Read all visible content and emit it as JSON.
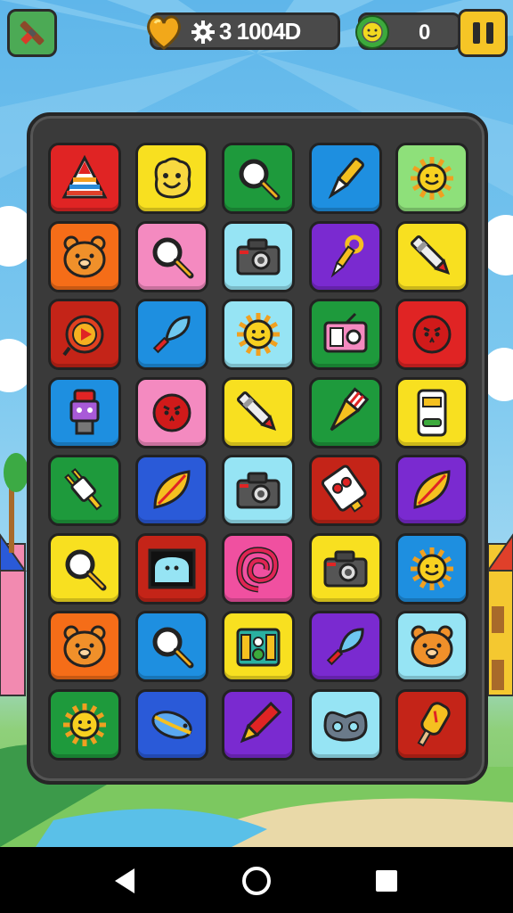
{
  "hud": {
    "coins": "3 1004D",
    "score": "0"
  },
  "colors": {
    "red": "#e02424",
    "yellow": "#f8e020",
    "green": "#1e9a3c",
    "blue": "#1e8fe0",
    "lightgreen": "#8ee07a",
    "orange": "#f56d18",
    "pink": "#f48ac0",
    "cyan": "#96e4f4",
    "purple": "#7a2ad0",
    "darkred": "#c42418",
    "royal": "#2a5ad8",
    "magenta": "#f050a0"
  },
  "board": {
    "rows": [
      [
        {
          "color": "red",
          "icon": "rainbow-pyramid-icon"
        },
        {
          "color": "yellow",
          "icon": "smiling-blob-icon"
        },
        {
          "color": "green",
          "icon": "magnifier-icon"
        },
        {
          "color": "blue",
          "icon": "pen-nib-icon"
        },
        {
          "color": "lightgreen",
          "icon": "sun-face-icon"
        }
      ],
      [
        {
          "color": "orange",
          "icon": "bear-face-icon"
        },
        {
          "color": "pink",
          "icon": "magnifier-icon"
        },
        {
          "color": "cyan",
          "icon": "camera-icon"
        },
        {
          "color": "purple",
          "icon": "wrench-pen-icon"
        },
        {
          "color": "yellow",
          "icon": "marker-icon"
        }
      ],
      [
        {
          "color": "darkred",
          "icon": "play-badge-icon"
        },
        {
          "color": "blue",
          "icon": "feather-brush-icon"
        },
        {
          "color": "cyan",
          "icon": "sun-face-icon"
        },
        {
          "color": "green",
          "icon": "radio-camera-icon"
        },
        {
          "color": "red",
          "icon": "round-face-icon"
        }
      ],
      [
        {
          "color": "blue",
          "icon": "robot-icon"
        },
        {
          "color": "pink",
          "icon": "round-face-icon"
        },
        {
          "color": "yellow",
          "icon": "marker-icon"
        },
        {
          "color": "green",
          "icon": "paint-brush-icon"
        },
        {
          "color": "yellow",
          "icon": "phone-icon"
        }
      ],
      [
        {
          "color": "green",
          "icon": "plug-icon"
        },
        {
          "color": "royal",
          "icon": "leaf-icon"
        },
        {
          "color": "cyan",
          "icon": "camera-icon"
        },
        {
          "color": "darkred",
          "icon": "card-pen-icon"
        },
        {
          "color": "purple",
          "icon": "leaf-icon"
        }
      ],
      [
        {
          "color": "yellow",
          "icon": "magnifier-icon"
        },
        {
          "color": "darkred",
          "icon": "tv-ghost-icon"
        },
        {
          "color": "magenta",
          "icon": "swirl-icon"
        },
        {
          "color": "yellow",
          "icon": "camera-icon"
        },
        {
          "color": "blue",
          "icon": "sun-face-icon"
        }
      ],
      [
        {
          "color": "orange",
          "icon": "bear-face-icon"
        },
        {
          "color": "blue",
          "icon": "magnifier-icon"
        },
        {
          "color": "yellow",
          "icon": "speaker-box-icon"
        },
        {
          "color": "purple",
          "icon": "feather-brush-icon"
        },
        {
          "color": "cyan",
          "icon": "bear-face-icon"
        }
      ],
      [
        {
          "color": "green",
          "icon": "sun-face-icon"
        },
        {
          "color": "royal",
          "icon": "fish-icon"
        },
        {
          "color": "purple",
          "icon": "pencil-icon"
        },
        {
          "color": "cyan",
          "icon": "mask-face-icon"
        },
        {
          "color": "darkred",
          "icon": "popsicle-icon"
        }
      ]
    ]
  }
}
